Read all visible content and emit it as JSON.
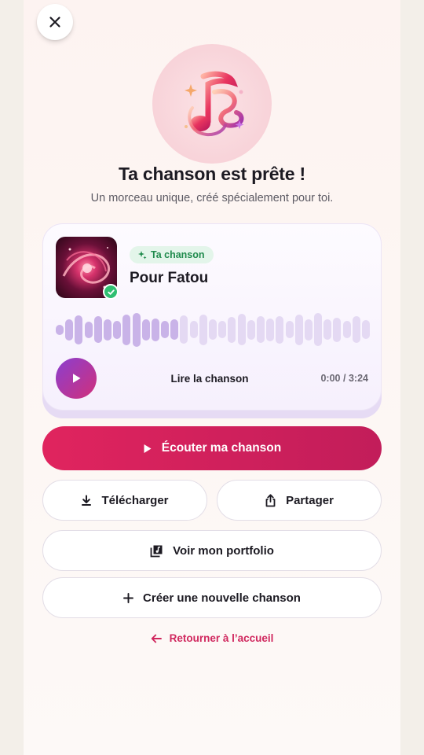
{
  "header": {
    "close_icon": "close-icon"
  },
  "hero": {
    "icon": "music-note-icon",
    "title": "Ta chanson est prête !",
    "subtitle": "Un morceau unique, créé spécialement pour toi."
  },
  "song_card": {
    "badge_label": "Ta chanson",
    "badge_icon": "sparkle-icon",
    "song_title": "Pour Fatou",
    "cover_status_icon": "check-icon",
    "waveform_levels": [
      0.3,
      0.62,
      0.85,
      0.48,
      0.78,
      0.62,
      0.52,
      0.88,
      0.98,
      0.62,
      0.66,
      0.5,
      0.6,
      0.82,
      0.5,
      0.88,
      0.6,
      0.5,
      0.74,
      0.9,
      0.56,
      0.78,
      0.66,
      0.8,
      0.5,
      0.88,
      0.62,
      0.96,
      0.6,
      0.7,
      0.5,
      0.78,
      0.55
    ],
    "play_label": "Lire la chanson",
    "time_current": "0:00",
    "time_separator": "/",
    "time_total": "3:24",
    "progress": 0
  },
  "actions": {
    "listen_label": "Écouter ma chanson",
    "download_label": "Télécharger",
    "share_label": "Partager",
    "portfolio_label": "Voir mon portfolio",
    "new_song_label": "Créer une nouvelle chanson",
    "back_label": "Retourner à l’accueil"
  },
  "colors": {
    "accent": "#d7245e",
    "play_gradient_start": "#8a3fd0",
    "play_gradient_end": "#d1307a",
    "badge_bg": "#e3f5ea",
    "badge_text": "#1f8a4c",
    "wave_played": "#c9b3e8",
    "wave_unplayed": "#e4d9f3"
  }
}
